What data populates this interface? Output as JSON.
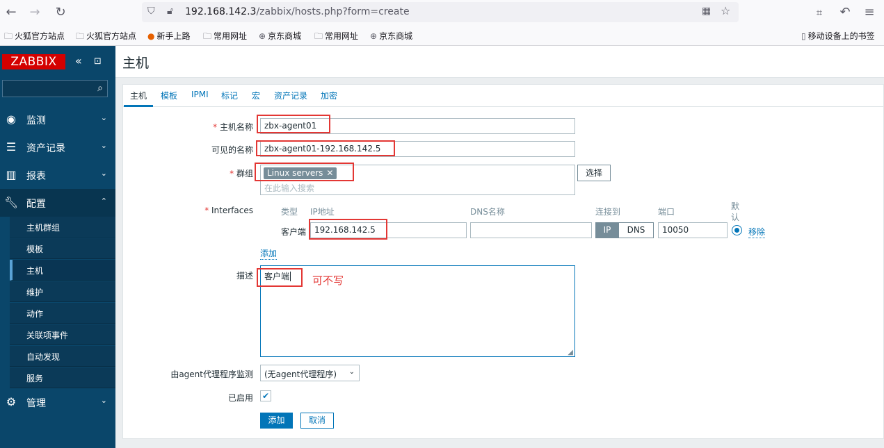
{
  "browser": {
    "url_host": "192.168.142.3",
    "url_path": "/zabbix/hosts.php?form=create",
    "bookmarks": [
      {
        "label": "火狐官方站点",
        "icon": "folder-icon"
      },
      {
        "label": "火狐官方站点",
        "icon": "folder-icon"
      },
      {
        "label": "新手上路",
        "icon": "firefox-icon"
      },
      {
        "label": "常用网址",
        "icon": "folder-icon"
      },
      {
        "label": "京东商城",
        "icon": "globe-icon"
      },
      {
        "label": "常用网址",
        "icon": "folder-icon"
      },
      {
        "label": "京东商城",
        "icon": "globe-icon"
      }
    ],
    "mobile_bookmarks": "移动设备上的书签"
  },
  "sidebar": {
    "logo": "ZABBIX",
    "menu": [
      {
        "label": "监测",
        "icon": "eye-icon"
      },
      {
        "label": "资产记录",
        "icon": "list-icon"
      },
      {
        "label": "报表",
        "icon": "bar-chart-icon"
      },
      {
        "label": "配置",
        "icon": "wrench-icon"
      },
      {
        "label": "管理",
        "icon": "gear-icon"
      }
    ],
    "submenu": [
      "主机群组",
      "模板",
      "主机",
      "维护",
      "动作",
      "关联项事件",
      "自动发现",
      "服务"
    ]
  },
  "page": {
    "title": "主机"
  },
  "tabs": [
    "主机",
    "模板",
    "IPMI",
    "标记",
    "宏",
    "资产记录",
    "加密"
  ],
  "form": {
    "host_name_label": "主机名称",
    "host_name_value": "zbx-agent01",
    "visible_name_label": "可见的名称",
    "visible_name_value": "zbx-agent01-192.168.142.5",
    "groups_label": "群组",
    "group_chip": "Linux servers",
    "groups_placeholder": "在此输入搜索",
    "select_button": "选择",
    "interfaces_label": "Interfaces",
    "iface_headers": {
      "type": "类型",
      "ip": "IP地址",
      "dns": "DNS名称",
      "connect": "连接到",
      "port": "端口",
      "default_1": "默",
      "default_2": "认"
    },
    "iface_type": "客户端",
    "iface_ip": "192.168.142.5",
    "iface_dns": "",
    "connect_ip": "IP",
    "connect_dns": "DNS",
    "iface_port": "10050",
    "remove_link": "移除",
    "add_link": "添加",
    "description_label": "描述",
    "description_value": "客户端",
    "annotation": "可不写",
    "proxy_label": "由agent代理程序监测",
    "proxy_value": "(无agent代理程序)",
    "enabled_label": "已启用",
    "add_button": "添加",
    "cancel_button": "取消"
  },
  "colors": {
    "accent": "#0275b8",
    "sidebar": "#0a466a",
    "logo": "#d40000",
    "annotation": "#e33734"
  }
}
